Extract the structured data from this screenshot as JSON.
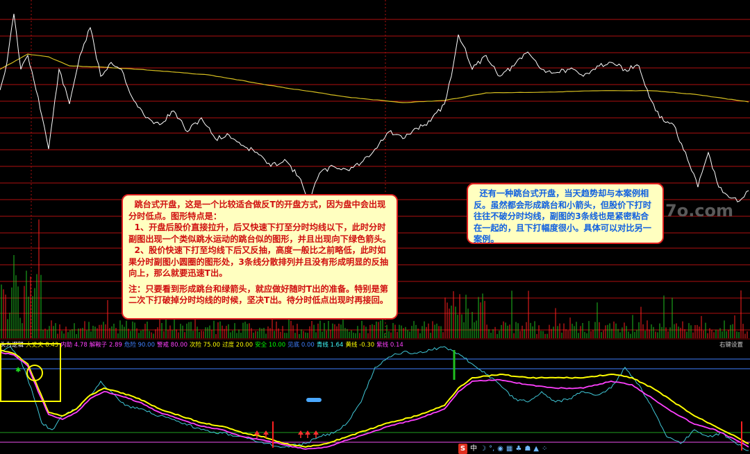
{
  "main_chart": {
    "price_line_color": "#ffffff",
    "avg_line_color": "#d8c020",
    "grid_color": "#b01010",
    "volume_color": "#ff2020",
    "volume_color_down": "#20c020"
  },
  "annotations": {
    "left": {
      "paragraphs": [
        "  跳台式开盘，这是一个比较适合做反T的开盘方式，因为盘中会出现分时低点。图形特点是：",
        "  1、开盘后股价直接拉升，后又快速下打至分时均线以下，此时分时副图出现一个类似跳水运动的跳台似的图形，并且出现向下绿色箭头。",
        "  2、股价快速下打至均线下后又反抽，高度一般比之前略低，此时如果分时副图小圆圈的图形处，3条线分散排列并且没有形成明显的反抽向上，那么就要迅速T出。",
        "注：只要看到形成跳台和绿箭头，就应做好随时T出的准备。特别是第二次下打破掉分时均线的时候，坚决T出。待分时低点出现时再接回。"
      ]
    },
    "right": {
      "paragraphs": [
        "  还有一种跳台式开盘，当天趋势却与本案例相反。虽然都会形成跳台和小箭头，但股价下打时往往不破分时均线，副图的3条线也是紧密粘合在一起的，且下打幅度很小。具体可以对比另一案例。"
      ]
    }
  },
  "watermark": "7o.com",
  "indicator_bar": {
    "items": [
      {
        "label": "头为逻辑",
        "value": "",
        "color": "#ffffff"
      },
      {
        "label": "大丈夫",
        "value": "8.43",
        "color": "#ffff00"
      },
      {
        "label": "内助",
        "value": "4.78",
        "color": "#ff40ff"
      },
      {
        "label": "解鞍子",
        "value": "2.89",
        "color": "#ff40ff"
      },
      {
        "label": "危险",
        "value": "90.00",
        "color": "#4080ff"
      },
      {
        "label": "警戒",
        "value": "80.00",
        "color": "#ff40ff"
      },
      {
        "label": "次险",
        "value": "75.00",
        "color": "#ffff00"
      },
      {
        "label": "过度",
        "value": "20.00",
        "color": "#ffff00"
      },
      {
        "label": "安全",
        "value": "10.00",
        "color": "#00ff00"
      },
      {
        "label": "见底",
        "value": "0.00",
        "color": "#4080ff"
      },
      {
        "label": "青线",
        "value": "1.64",
        "color": "#40ffff"
      },
      {
        "label": "黄线",
        "value": "-0.30",
        "color": "#ffff00"
      },
      {
        "label": "紫线",
        "value": "0.14",
        "color": "#ff40ff"
      }
    ],
    "right_settings": "右键设置"
  },
  "sub_chart": {
    "cyan_line_color": "#40c8d8",
    "yellow_line_color": "#ffff00",
    "magenta_line_color": "#ff40ff",
    "level_line_colors": [
      "#4080ff",
      "#20a020",
      "#c040c0"
    ],
    "arrow_color": "#ff3030",
    "green_bar_color": "#20c020"
  },
  "toolbar": {
    "items": [
      {
        "name": "sogou-s-icon",
        "glyph": "S"
      },
      {
        "name": "chinese-input-icon",
        "glyph": "中"
      },
      {
        "name": "moon-icon",
        "glyph": "☽"
      },
      {
        "name": "punctuation-icon",
        "glyph": "°,"
      },
      {
        "name": "voice-icon",
        "glyph": "◉"
      },
      {
        "name": "keyboard-icon",
        "glyph": "▦"
      },
      {
        "name": "skin-icon",
        "glyph": "♣"
      },
      {
        "name": "user-icon",
        "glyph": "☗"
      },
      {
        "name": "shirt-icon",
        "glyph": "▲"
      },
      {
        "name": "tools-icon",
        "glyph": "⁘"
      }
    ]
  }
}
